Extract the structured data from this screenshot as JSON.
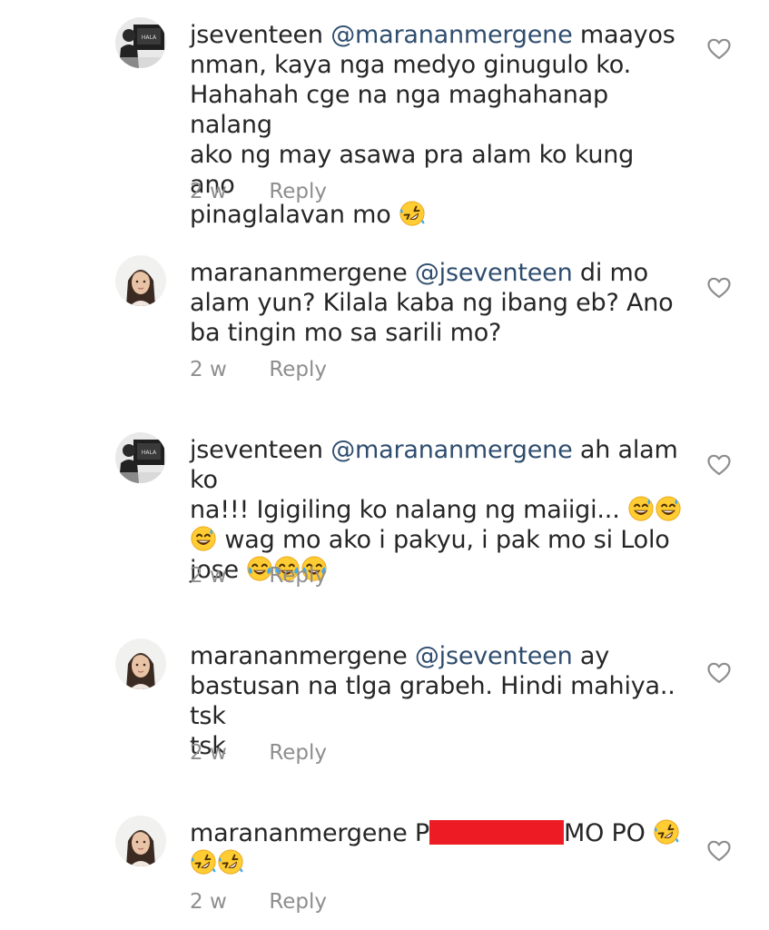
{
  "comments": [
    {
      "username": "jseventeen",
      "mention": "@marananmergene",
      "lines": [
        "maayos",
        "nman, kaya nga medyo ginugulo ko.",
        "Hahahah cge na nga maghahanap nalang",
        "ako ng may asawa pra alam ko kung ano",
        "pinaglalavan mo"
      ],
      "time": "2 w",
      "reply": "Reply"
    },
    {
      "username": "marananmergene",
      "mention": "@jseventeen",
      "lines": [
        "di mo",
        "alam yun? Kilala kaba ng ibang eb? Ano",
        "ba tingin mo sa sarili mo?"
      ],
      "time": "2 w",
      "reply": "Reply"
    },
    {
      "username": "jseventeen",
      "mention": "@marananmergene",
      "lines": [
        "ah alam ko",
        "na!!! Igigiling ko nalang ng maiigi...",
        "wag mo ako i pakyu, i pak mo si Lolo",
        "jose"
      ],
      "time": "2 w",
      "reply": "Reply"
    },
    {
      "username": "marananmergene",
      "mention": "@jseventeen",
      "lines": [
        "ay",
        "bastusan na tlga grabeh. Hindi mahiya.. tsk",
        "tsk"
      ],
      "time": "2 w",
      "reply": "Reply"
    },
    {
      "username": "marananmergene",
      "lines": [
        "P",
        "MO PO"
      ],
      "time": "2 w",
      "reply": "Reply"
    }
  ],
  "icons": {
    "like": "heart-outline-icon",
    "rofl": "rolling-on-floor-laughing-emoji",
    "sweat": "grinning-sweat-emoji",
    "tears": "face-with-tears-of-joy-emoji"
  },
  "colors": {
    "text": "#262626",
    "mention": "#2f4d6f",
    "meta": "#8e8e8e",
    "redaction": "#ed1c24"
  }
}
